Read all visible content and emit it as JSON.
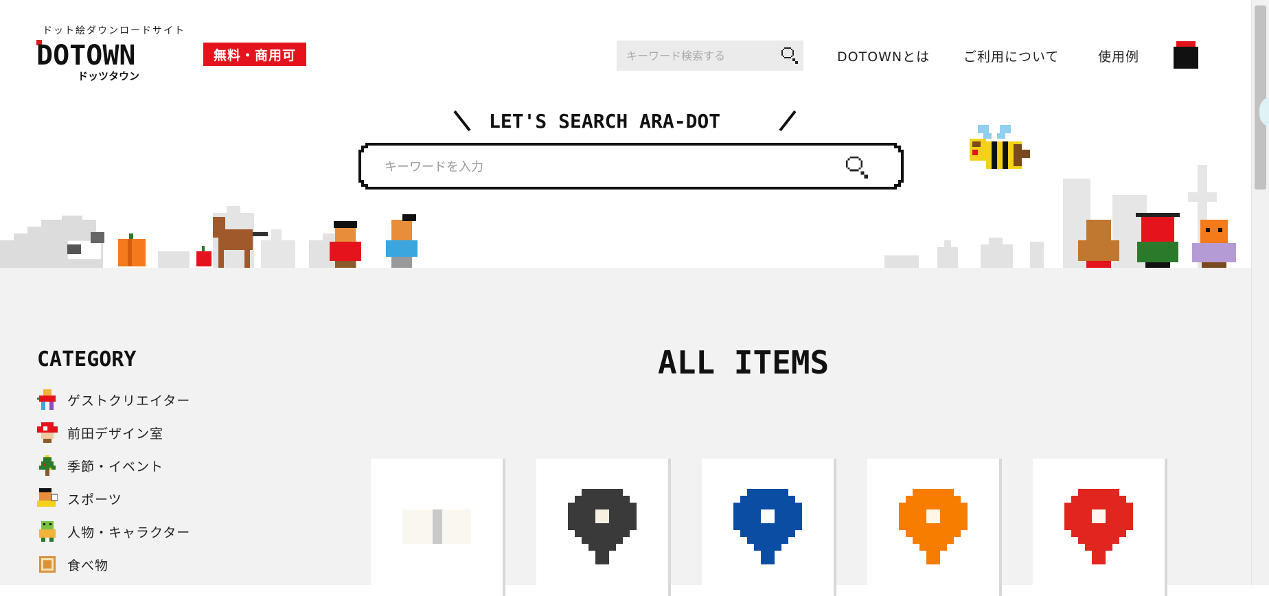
{
  "header": {
    "tagline": "ドット絵ダウンロードサイト",
    "logo_text": "DOTOWN",
    "logo_kana": "ドッツタウン",
    "badge": "無料・商用可",
    "search": {
      "placeholder": "キーワード検索する",
      "icon": "search-icon"
    },
    "nav": [
      {
        "label": "DOTOWNとは"
      },
      {
        "label": "ご利用について"
      },
      {
        "label": "使用例"
      }
    ],
    "cart_icon": "cube-icon"
  },
  "hero": {
    "catchphrase": "LET'S SEARCH ARA-DOT",
    "search": {
      "placeholder": "キーワードを入力",
      "icon": "search-icon"
    }
  },
  "sidebar": {
    "title": "CATEGORY",
    "items": [
      {
        "label": "ゲストクリエイター",
        "icon": "guest-icon"
      },
      {
        "label": "前田デザイン室",
        "icon": "mushroom-icon"
      },
      {
        "label": "季節・イベント",
        "icon": "tree-icon"
      },
      {
        "label": "スポーツ",
        "icon": "sports-icon"
      },
      {
        "label": "人物・キャラクター",
        "icon": "character-icon"
      },
      {
        "label": "食べ物",
        "icon": "food-icon"
      }
    ]
  },
  "main": {
    "title": "ALL ITEMS",
    "items": [
      {
        "name": "paper-item",
        "color": "#c9c9c9"
      },
      {
        "name": "map-pin-black",
        "color": "#3a3a3a"
      },
      {
        "name": "map-pin-blue",
        "color": "#0a4ea4"
      },
      {
        "name": "map-pin-orange",
        "color": "#f77d00"
      },
      {
        "name": "map-pin-red",
        "color": "#e0261f"
      }
    ]
  },
  "colors": {
    "accent": "#e5141c",
    "background": "#f2f2f2"
  }
}
